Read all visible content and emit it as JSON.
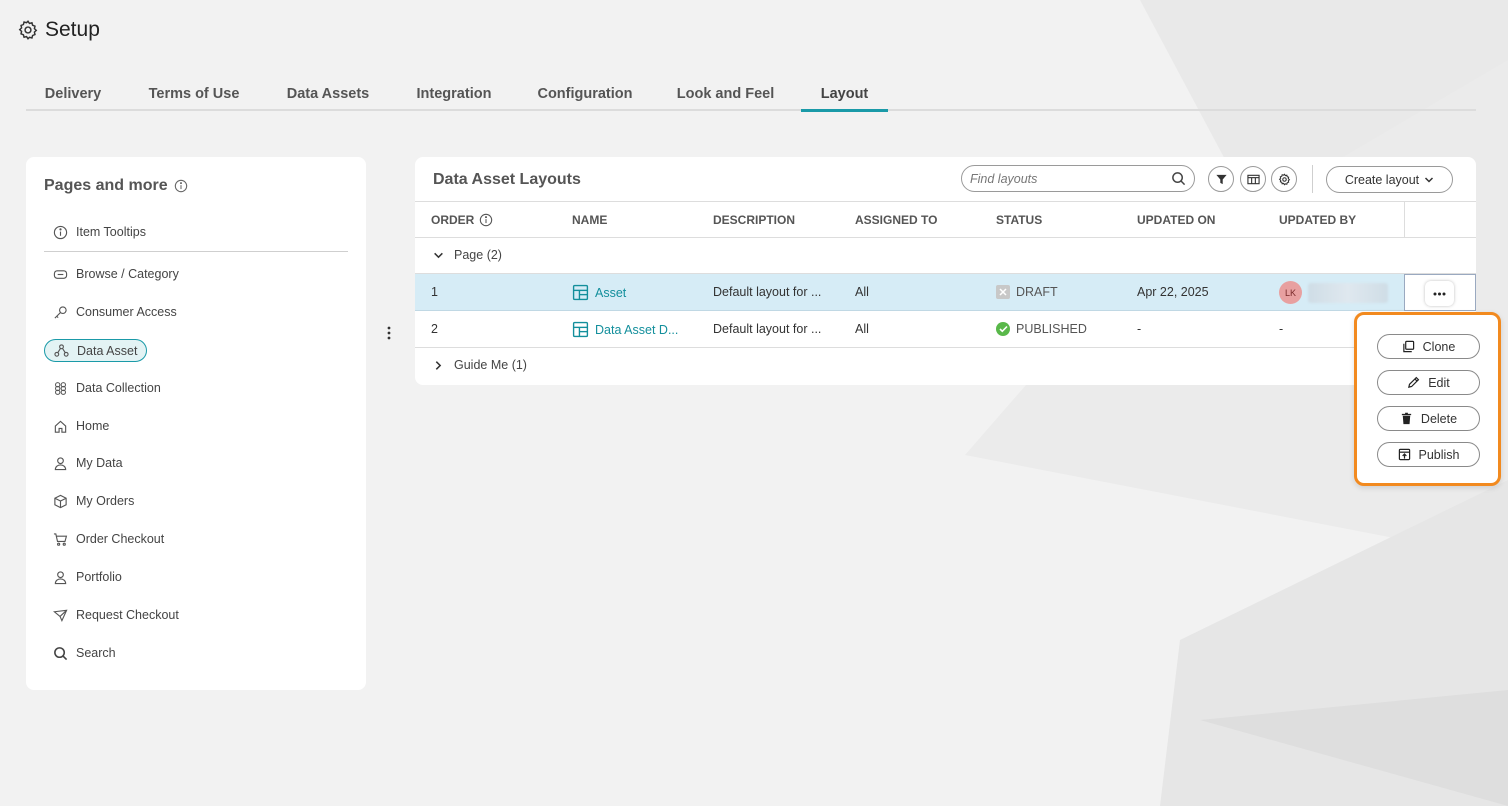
{
  "header": {
    "title": "Setup",
    "icon": "gear-icon"
  },
  "tabs": [
    {
      "label": "Delivery"
    },
    {
      "label": "Terms of Use"
    },
    {
      "label": "Data Assets"
    },
    {
      "label": "Integration"
    },
    {
      "label": "Configuration"
    },
    {
      "label": "Look and Feel"
    },
    {
      "label": "Layout",
      "active": true
    }
  ],
  "sidebar": {
    "title": "Pages and more",
    "items": [
      {
        "label": "Item Tooltips",
        "icon": "info-icon"
      },
      {
        "label": "Browse / Category",
        "icon": "browse-icon"
      },
      {
        "label": "Consumer Access",
        "icon": "key-icon"
      },
      {
        "label": "Data Asset",
        "icon": "data-asset-icon",
        "selected": true
      },
      {
        "label": "Data Collection",
        "icon": "data-collection-icon"
      },
      {
        "label": "Home",
        "icon": "home-icon"
      },
      {
        "label": "My Data",
        "icon": "user-icon"
      },
      {
        "label": "My Orders",
        "icon": "box-icon"
      },
      {
        "label": "Order Checkout",
        "icon": "cart-icon"
      },
      {
        "label": "Portfolio",
        "icon": "user-icon"
      },
      {
        "label": "Request Checkout",
        "icon": "send-icon"
      },
      {
        "label": "Search",
        "icon": "search-icon"
      }
    ]
  },
  "main": {
    "title": "Data Asset Layouts",
    "search": {
      "placeholder": "Find layouts",
      "value": ""
    },
    "create_label": "Create layout",
    "columns": {
      "order": "ORDER",
      "name": "NAME",
      "description": "DESCRIPTION",
      "assigned_to": "ASSIGNED TO",
      "status": "STATUS",
      "updated_on": "UPDATED ON",
      "updated_by": "UPDATED BY"
    },
    "groups": [
      {
        "label": "Page",
        "count": "(2)",
        "expanded": true,
        "rows": [
          {
            "order": "1",
            "name": "Asset",
            "description": "Default layout for ...",
            "assigned_to": "All",
            "status": "DRAFT",
            "updated_on": "Apr 22, 2025",
            "updated_by_initials": "LK",
            "selected": true
          },
          {
            "order": "2",
            "name": "Data Asset D...",
            "description": "Default layout for ...",
            "assigned_to": "All",
            "status": "PUBLISHED",
            "updated_on": "-",
            "updated_by": "-"
          }
        ]
      },
      {
        "label": "Guide Me",
        "count": "(1)",
        "expanded": false
      }
    ]
  },
  "row_menu": {
    "clone": "Clone",
    "edit": "Edit",
    "delete": "Delete",
    "publish": "Publish"
  },
  "colors": {
    "accent": "#1a9aa8",
    "highlight_border": "#f28a1f",
    "selected_row": "#d6ecf6",
    "published": "#59b84a"
  }
}
